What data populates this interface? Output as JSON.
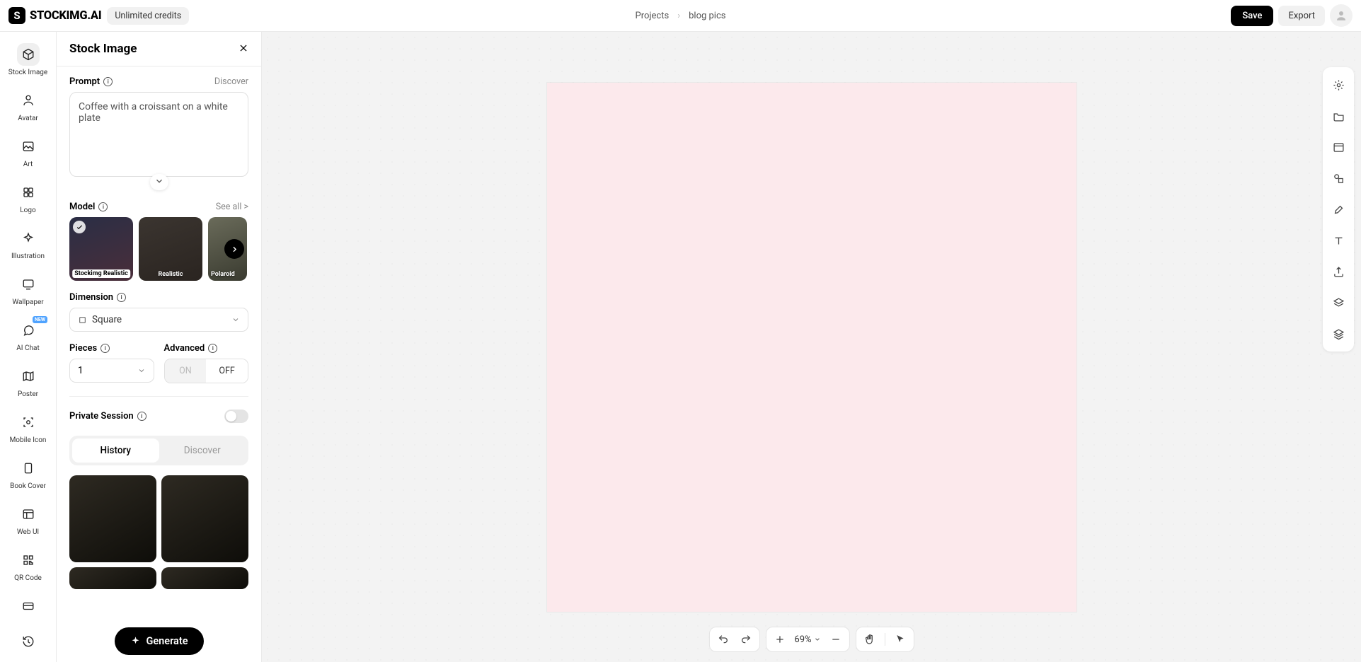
{
  "header": {
    "logo_text": "STOCKIMG.AI",
    "credits_label": "Unlimited credits",
    "breadcrumb_root": "Projects",
    "breadcrumb_current": "blog pics",
    "save_label": "Save",
    "export_label": "Export"
  },
  "leftnav": {
    "items": [
      {
        "label": "Stock Image"
      },
      {
        "label": "Avatar"
      },
      {
        "label": "Art"
      },
      {
        "label": "Logo"
      },
      {
        "label": "Illustration"
      },
      {
        "label": "Wallpaper"
      },
      {
        "label": "AI Chat",
        "badge": "NEW"
      },
      {
        "label": "Poster"
      },
      {
        "label": "Mobile Icon"
      },
      {
        "label": "Book Cover"
      },
      {
        "label": "Web UI"
      },
      {
        "label": "QR Code"
      }
    ]
  },
  "panel": {
    "title": "Stock Image",
    "prompt_label": "Prompt",
    "prompt_discover": "Discover",
    "prompt_value": "Coffee with a croissant on a white plate",
    "model_label": "Model",
    "model_see_all": "See all >",
    "models": [
      {
        "name": "Stockimg Realistic"
      },
      {
        "name": "Realistic"
      },
      {
        "name": "Polaroid"
      }
    ],
    "dimension_label": "Dimension",
    "dimension_value": "Square",
    "pieces_label": "Pieces",
    "pieces_value": "1",
    "advanced_label": "Advanced",
    "advanced_on": "ON",
    "advanced_off": "OFF",
    "private_label": "Private Session",
    "tab_history": "History",
    "tab_discover": "Discover",
    "generate_label": "Generate"
  },
  "canvas": {
    "zoom_text": "69%"
  }
}
